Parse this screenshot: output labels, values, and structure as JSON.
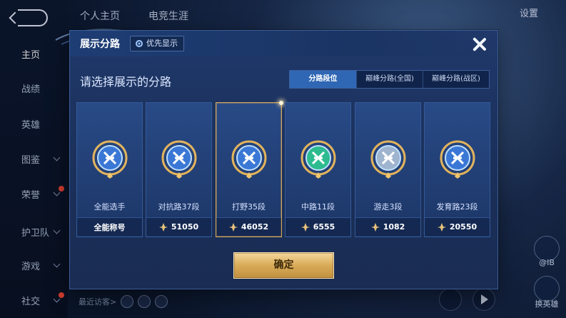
{
  "background": {
    "top_tabs": [
      "个人主页",
      "电竞生涯"
    ],
    "settings_label": "设置",
    "sidebar": [
      {
        "label": "主页",
        "active": true,
        "chevron": false,
        "dot": false
      },
      {
        "label": "战绩",
        "active": false,
        "chevron": false,
        "dot": false
      },
      {
        "label": "英雄",
        "active": false,
        "chevron": false,
        "dot": false
      },
      {
        "label": "图鉴",
        "active": false,
        "chevron": true,
        "dot": false
      },
      {
        "label": "荣誉",
        "active": false,
        "chevron": true,
        "dot": true
      },
      {
        "label": "护卫队",
        "active": false,
        "chevron": true,
        "dot": false
      },
      {
        "label": "游戏",
        "active": false,
        "chevron": true,
        "dot": false
      },
      {
        "label": "社交",
        "active": false,
        "chevron": true,
        "dot": true
      }
    ],
    "recent_visitors_label": "最近访客>",
    "right_buttons": [
      "@IB",
      "换英雄"
    ]
  },
  "modal": {
    "title": "展示分路",
    "priority_button": "优先显示",
    "subtitle": "请选择展示的分路",
    "tabs": [
      {
        "label": "分路段位",
        "active": true
      },
      {
        "label": "巅峰分路(全国)",
        "active": false
      },
      {
        "label": "巅峰分路(战区)",
        "active": false
      }
    ],
    "cards": [
      {
        "name": "全能选手",
        "footer_title": "全能称号",
        "value": null,
        "selected": false,
        "emblem": "allround-emblem-icon",
        "color": "#3b78d6"
      },
      {
        "name": "对抗路37段",
        "footer_title": null,
        "value": "51050",
        "selected": false,
        "emblem": "clash-lane-emblem-icon",
        "color": "#3b78d6"
      },
      {
        "name": "打野35段",
        "footer_title": null,
        "value": "46052",
        "selected": true,
        "emblem": "jungle-emblem-icon",
        "color": "#3b78d6"
      },
      {
        "name": "中路11段",
        "footer_title": null,
        "value": "6555",
        "selected": false,
        "emblem": "mid-lane-emblem-icon",
        "color": "#2dbb8f"
      },
      {
        "name": "游走3段",
        "footer_title": null,
        "value": "1082",
        "selected": false,
        "emblem": "roam-emblem-icon",
        "color": "#9fb4cf"
      },
      {
        "name": "发育路23段",
        "footer_title": null,
        "value": "20550",
        "selected": false,
        "emblem": "farm-lane-emblem-icon",
        "color": "#3b78d6"
      }
    ],
    "confirm_label": "确定"
  },
  "colors": {
    "accent_gold": "#d6a85b",
    "active_tab": "#2f67b4",
    "modal_bg": "#1a2f59"
  }
}
